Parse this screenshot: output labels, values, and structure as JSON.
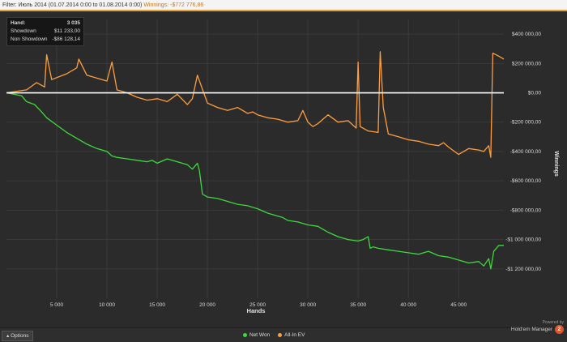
{
  "filter": {
    "prefix": "Filter:",
    "period": "Июль 2014 (01.07.2014 0:00 to 01.08.2014 0:00)",
    "winnings_label": "Winnings:",
    "winnings_value": "-$772 776,86"
  },
  "stats": {
    "hand_label": "Hand:",
    "hand_value": "3 035",
    "showdown_label": "Showdown",
    "showdown_value": "$11 233,00",
    "nonshowdown_label": "Non Showdown",
    "nonshowdown_value": "-$86 128,14"
  },
  "bottom": {
    "options_label": "Options",
    "powered_by": "Powered by",
    "brand_name": "Hold'em Manager",
    "brand_logo": "2"
  },
  "colors": {
    "net_won": "#3dd93d",
    "all_in_ev": "#ff9e3d",
    "zero_line": "#ffffff",
    "grid": "#3b3b3b"
  },
  "chart_data": {
    "type": "line",
    "xlabel": "Hands",
    "ylabel": "Winnings",
    "xlim": [
      0,
      49500
    ],
    "ylim": [
      -1400000,
      500000
    ],
    "xticks": [
      5000,
      10000,
      15000,
      20000,
      25000,
      30000,
      35000,
      40000,
      45000
    ],
    "xtick_labels": [
      "5 000",
      "10 000",
      "15 000",
      "20 000",
      "25 000",
      "30 000",
      "35 000",
      "40 000",
      "45 000"
    ],
    "yticks": [
      400000,
      200000,
      0,
      -200000,
      -400000,
      -600000,
      -800000,
      -1000000,
      -1200000
    ],
    "ytick_labels": [
      "$400 000,00",
      "$200 000,00",
      "$0,00",
      "-$200 000,00",
      "-$400 000,00",
      "-$600 000,00",
      "-$800 000,00",
      "-$1 000 000,00",
      "-$1 200 000,00"
    ],
    "legend": [
      "Net Won",
      "All-In EV"
    ],
    "legend_position": "bottom-center",
    "grid": true,
    "series": [
      {
        "name": "Net Won",
        "color": "#3dd93d",
        "x": [
          0,
          1500,
          2000,
          2800,
          3500,
          4000,
          5000,
          6000,
          7000,
          8000,
          9000,
          10000,
          10500,
          11000,
          12000,
          13000,
          14000,
          14500,
          15000,
          16000,
          17000,
          18000,
          18500,
          19000,
          19200,
          19500,
          20000,
          21000,
          22000,
          23000,
          24000,
          25000,
          26000,
          27000,
          27500,
          28000,
          29000,
          30000,
          31000,
          31500,
          32000,
          33000,
          34000,
          35000,
          35500,
          36000,
          36200,
          36500,
          37000,
          38000,
          39000,
          40000,
          41000,
          42000,
          43000,
          44000,
          45000,
          46000,
          47000,
          47500,
          48000,
          48200,
          48500,
          49000,
          49500
        ],
        "y": [
          0,
          -20000,
          -60000,
          -80000,
          -130000,
          -170000,
          -220000,
          -270000,
          -310000,
          -350000,
          -380000,
          -400000,
          -430000,
          -440000,
          -450000,
          -460000,
          -470000,
          -460000,
          -480000,
          -450000,
          -470000,
          -490000,
          -520000,
          -480000,
          -530000,
          -690000,
          -710000,
          -720000,
          -740000,
          -760000,
          -770000,
          -790000,
          -820000,
          -840000,
          -850000,
          -870000,
          -880000,
          -900000,
          -910000,
          -930000,
          -950000,
          -980000,
          -1000000,
          -1010000,
          -1000000,
          -980000,
          -1060000,
          -1050000,
          -1060000,
          -1070000,
          -1080000,
          -1090000,
          -1100000,
          -1080000,
          -1110000,
          -1120000,
          -1140000,
          -1160000,
          -1150000,
          -1180000,
          -1130000,
          -1200000,
          -1080000,
          -1040000,
          -1040000
        ]
      },
      {
        "name": "All-In EV",
        "color": "#ff9e3d",
        "x": [
          0,
          2000,
          3000,
          3800,
          4000,
          4500,
          6000,
          7000,
          7200,
          8000,
          9000,
          10000,
          10500,
          11000,
          12000,
          13000,
          14000,
          15000,
          16000,
          17000,
          18000,
          18500,
          19000,
          20000,
          21000,
          22000,
          23000,
          24000,
          24500,
          25000,
          26000,
          27000,
          28000,
          29000,
          29500,
          30000,
          30500,
          31000,
          32000,
          33000,
          34000,
          34800,
          35000,
          35200,
          36000,
          37000,
          37200,
          37500,
          38000,
          39000,
          40000,
          41000,
          42000,
          43000,
          43500,
          44000,
          45000,
          46000,
          47000,
          47500,
          48000,
          48200,
          48400,
          49000,
          49500
        ],
        "y": [
          0,
          20000,
          70000,
          40000,
          260000,
          90000,
          130000,
          170000,
          230000,
          120000,
          100000,
          80000,
          210000,
          20000,
          0,
          -30000,
          -50000,
          -40000,
          -60000,
          -10000,
          -80000,
          -40000,
          120000,
          -70000,
          -100000,
          -120000,
          -100000,
          -140000,
          -130000,
          -150000,
          -170000,
          -180000,
          -200000,
          -190000,
          -120000,
          -200000,
          -230000,
          -210000,
          -150000,
          -200000,
          -190000,
          -240000,
          210000,
          -230000,
          -260000,
          -270000,
          280000,
          -100000,
          -280000,
          -300000,
          -320000,
          -330000,
          -350000,
          -360000,
          -340000,
          -370000,
          -420000,
          -380000,
          -390000,
          -400000,
          -360000,
          -440000,
          270000,
          250000,
          230000
        ]
      }
    ]
  }
}
